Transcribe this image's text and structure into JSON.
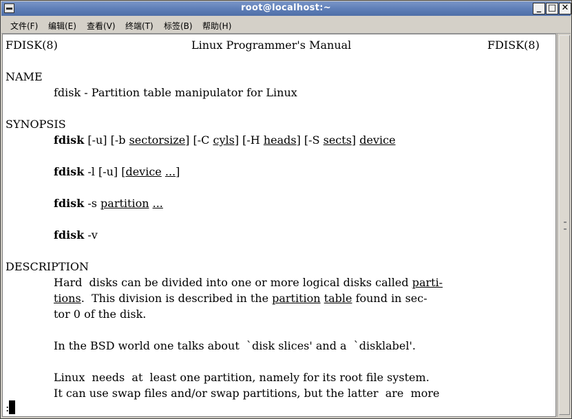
{
  "window": {
    "title": "root@localhost:~",
    "controls": {
      "minimize": "_",
      "maximize": "□",
      "close": "✕"
    }
  },
  "menubar": {
    "items": [
      "文件(F)",
      "编辑(E)",
      "查看(V)",
      "终端(T)",
      "标签(B)",
      "帮助(H)"
    ]
  },
  "terminal": {
    "header_left": "FDISK(8)",
    "header_center": "Linux Programmer's Manual",
    "header_right": "FDISK(8)",
    "name_heading": "NAME",
    "name_text": "fdisk - Partition table manipulator for Linux",
    "synopsis_heading": "SYNOPSIS",
    "syn1": {
      "cmd": "fdisk",
      "p1": " [-u] [-b ",
      "a1": "sectorsize",
      "p2": "] [-C ",
      "a2": "cyls",
      "p3": "] [-H ",
      "a3": "heads",
      "p4": "] [-S ",
      "a4": "sects",
      "p5": "] ",
      "a5": "device"
    },
    "syn2": {
      "cmd": "fdisk",
      "p1": " -l [-u] [",
      "a1": "device",
      "p2": " ",
      "a2": "...",
      "p3": "]"
    },
    "syn3": {
      "cmd": "fdisk",
      "p1": " -s ",
      "a1": "partition",
      "p2": " ",
      "a2": "..."
    },
    "syn4": {
      "cmd": "fdisk",
      "p1": " -v"
    },
    "description_heading": "DESCRIPTION",
    "desc1": {
      "p1": "Hard  disks can be divided into one or more logical disks called ",
      "u1": "parti-"
    },
    "desc2": {
      "u1": "tions",
      "p1": ".  This division is described in the ",
      "u2": "partition",
      "p2": " ",
      "u3": "table",
      "p3": " found in sec-"
    },
    "desc3": "tor 0 of the disk.",
    "desc4": "In the BSD world one talks about  `disk slices' and a  `disklabel'.",
    "desc5": "Linux  needs  at  least one partition, namely for its root file system.",
    "desc6": "It can use swap files and/or swap partitions, but the latter  are  more",
    "prompt": ":"
  }
}
